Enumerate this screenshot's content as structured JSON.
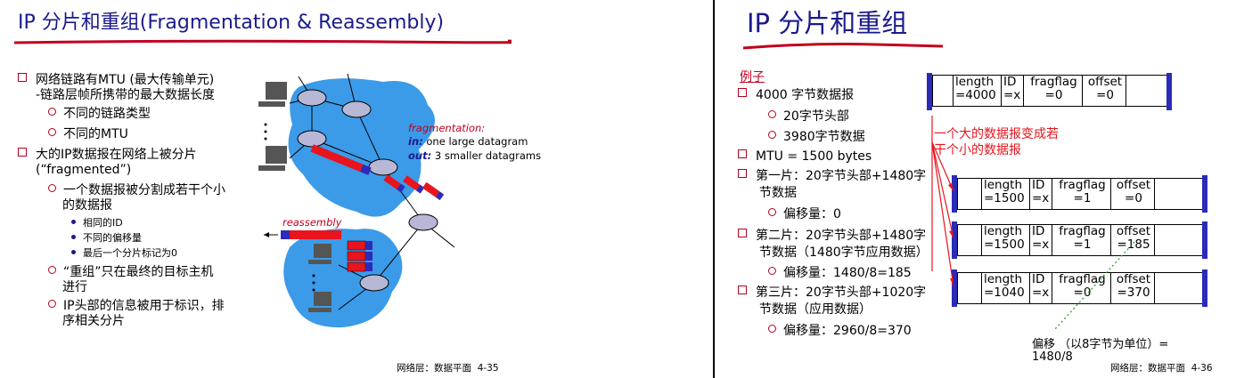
{
  "left": {
    "title": "IP 分片和重组(Fragmentation & Reassembly)",
    "bullets": {
      "b1_l1": "网络链路有MTU (最大传输单元)",
      "b1_l2": "-链路层帧所携带的最大数据长度",
      "b1_s1": "不同的链路类型",
      "b1_s2": "不同的MTU",
      "b2_l1": "大的IP数据报在网络上被分片",
      "b2_l2": "(“fragmented”)",
      "b2_s1_l1": "一个数据报被分割成若干个小",
      "b2_s1_l2": "的数据报",
      "d1": "相同的ID",
      "d2": "不同的偏移量",
      "d3": "最后一个分片标记为0",
      "b2_s2_l1": "“重组”只在最终的目标主机",
      "b2_s2_l2": "进行",
      "b2_s3_l1": "IP头部的信息被用于标识，排",
      "b2_s3_l2": "序相关分片"
    },
    "figure": {
      "frag_label": "fragmentation:",
      "in_label": "in:",
      "in_text": " one large datagram",
      "out_label": "out:",
      "out_text": " 3 smaller datagrams",
      "reassembly_label": "reassembly"
    },
    "footer": "网络层：数据平面",
    "page": "4-35"
  },
  "right": {
    "title": "IP 分片和重组",
    "example": "例子",
    "items": {
      "i1": "4000 字节数据报",
      "i1_s1": "20字节头部",
      "i1_s2": "3980字节数据",
      "i2": "MTU = 1500 bytes",
      "i3_l1": "第一片：20字节头部+1480字",
      "i3_l2": "节数据",
      "i3_s": "偏移量：0",
      "i4_l1": "第二片：20字节头部+1480字",
      "i4_l2": "节数据（1480字节应用数据）",
      "i4_s": "偏移量：1480/8=185",
      "i5_l1": "第三片：20字节头部+1020字",
      "i5_l2": "节数据（应用数据）",
      "i5_s": "偏移量：2960/8=370"
    },
    "red_note_l1": "一个大的数据报变成若",
    "red_note_l2": "干个小的数据报",
    "header_labels": {
      "length": "length",
      "id": "ID",
      "fragflag": "fragflag",
      "offset": "offset"
    },
    "orig": {
      "length": "=4000",
      "id": "=x",
      "fragflag": "=0",
      "offset": "=0"
    },
    "frag1": {
      "length": "=1500",
      "id": "=x",
      "fragflag": "=1",
      "offset": "=0"
    },
    "frag2": {
      "length": "=1500",
      "id": "=x",
      "fragflag": "=1",
      "offset": "=185"
    },
    "frag3": {
      "length": "=1040",
      "id": "=x",
      "fragflag": "=0",
      "offset": "=370"
    },
    "offset_note_l1": "偏移  （以8字节为单位）=",
    "offset_note_l2": "1480/8",
    "footer": "网络层：数据平面",
    "page": "4-36"
  }
}
